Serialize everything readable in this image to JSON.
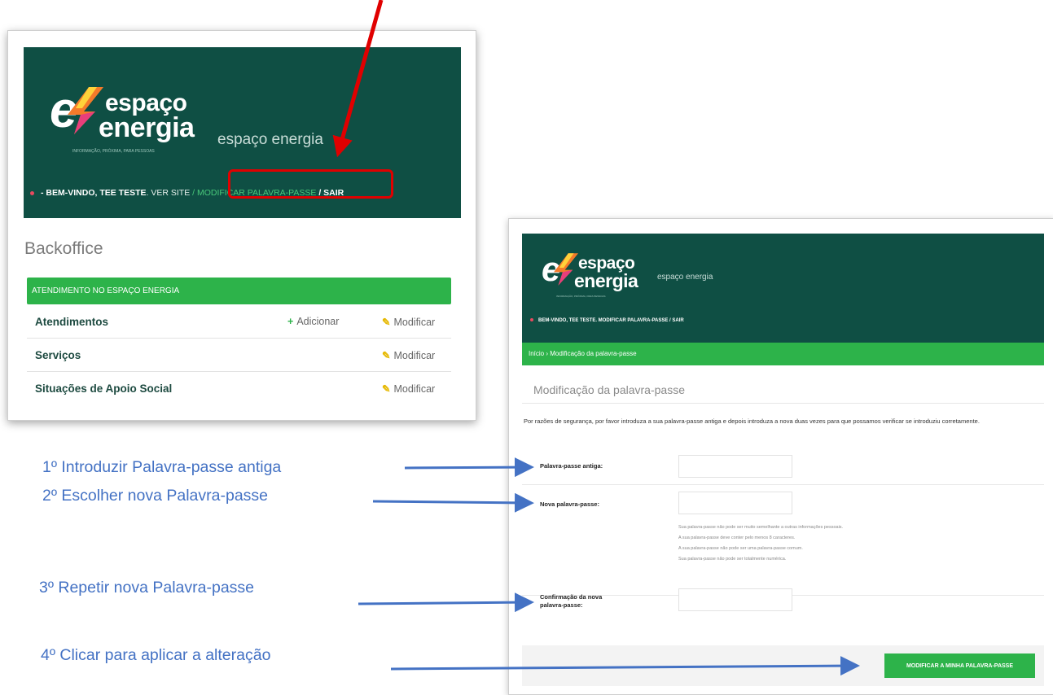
{
  "colors": {
    "header_green": "#0f4f44",
    "accent_green": "#2db34a",
    "annotation_blue": "#4472c4",
    "annotation_red": "#e00000"
  },
  "backoffice_screen": {
    "logo": {
      "line1": "espaço",
      "line2": "energia",
      "tagline": "INFORMAÇÃO, PRÓXIMA, PARA PESSOAS"
    },
    "site_name": "espaço energia",
    "userbar": {
      "welcome": "- BEM-VINDO,",
      "user": "TEE TESTE",
      "view_site": ". VER SITE",
      "change_password": "/ MODIFICAR PALAVRA-PASSE",
      "logout": "/ SAIR"
    },
    "title": "Backoffice",
    "section_header": "ATENDIMENTO NO ESPAÇO ENERGIA",
    "rows": [
      {
        "label": "Atendimentos",
        "add": "Adicionar",
        "edit": "Modificar"
      },
      {
        "label": "Serviços",
        "edit": "Modificar"
      },
      {
        "label": "Situações de Apoio Social",
        "edit": "Modificar"
      }
    ],
    "icons": {
      "add": "plus-icon",
      "edit": "pencil-icon"
    }
  },
  "password_screen": {
    "logo": {
      "line1": "espaço",
      "line2": "energia",
      "tagline": "INFORMAÇÃO, PRÓXIMA, PARA PESSOAS"
    },
    "site_name": "espaço energia",
    "userbar": "BEM-VINDO, TEE TESTE. MODIFICAR PALAVRA-PASSE / SAIR",
    "breadcrumb": "Início › Modificação da palavra-passe",
    "title": "Modificação da palavra-passe",
    "intro": "Por razões de segurança, por favor introduza a sua palavra-passe antiga e depois introduza a nova duas vezes para que possamos verificar se introduziu corretamente.",
    "fields": {
      "old_password_label": "Palavra-passe antiga:",
      "new_password_label": "Nova palavra-passe:",
      "confirm_password_label": "Confirmação da nova palavra-passe:"
    },
    "hints": [
      "Sua palavra-passe não pode ser muito semelhante a outras informações pessoais.",
      "A sua palavra-passe deve conter pelo menos 8 caracteres.",
      "A sua palavra-passe não pode ser uma palavra-passe comum.",
      "Sua palavra-passe não pode ser totalmente numérica."
    ],
    "submit_label": "MODIFICAR A MINHA PALAVRA-PASSE"
  },
  "annotations": {
    "step1": "1º Introduzir Palavra-passe antiga",
    "step2": "2º Escolher nova Palavra-passe",
    "step3": "3º Repetir nova Palavra-passe",
    "step4": "4º Clicar para aplicar a alteração"
  }
}
